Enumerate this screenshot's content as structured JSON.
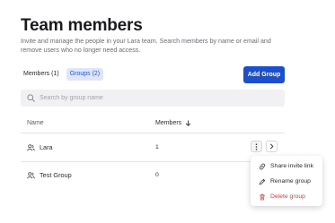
{
  "header": {
    "title": "Team members",
    "subtitle": "Invite and manage the people in your Lara team. Search members by name or email and remove users who no longer need access."
  },
  "tabs": [
    {
      "label": "Members (1)",
      "active": false
    },
    {
      "label": "Groups (2)",
      "active": true
    }
  ],
  "actions": {
    "add_group_label": "Add Group"
  },
  "search": {
    "placeholder": "Search by group name",
    "value": ""
  },
  "table": {
    "columns": [
      {
        "label": "Name"
      },
      {
        "label": "Members",
        "sort": "descending"
      }
    ],
    "rows": [
      {
        "name": "Lara",
        "members": "1",
        "icon": "users-icon"
      },
      {
        "name": "Test Group",
        "members": "0",
        "icon": "users-icon"
      }
    ]
  },
  "row_menu": {
    "items": [
      {
        "label": "Share invite link",
        "icon": "link-icon",
        "danger": false
      },
      {
        "label": "Rename group",
        "icon": "pencil-icon",
        "danger": false
      },
      {
        "label": "Delete group",
        "icon": "trash-icon",
        "danger": true
      }
    ]
  },
  "colors": {
    "accent": "#1c4fce",
    "tab_active_bg": "#dfe6fb",
    "danger": "#d63c3c"
  }
}
